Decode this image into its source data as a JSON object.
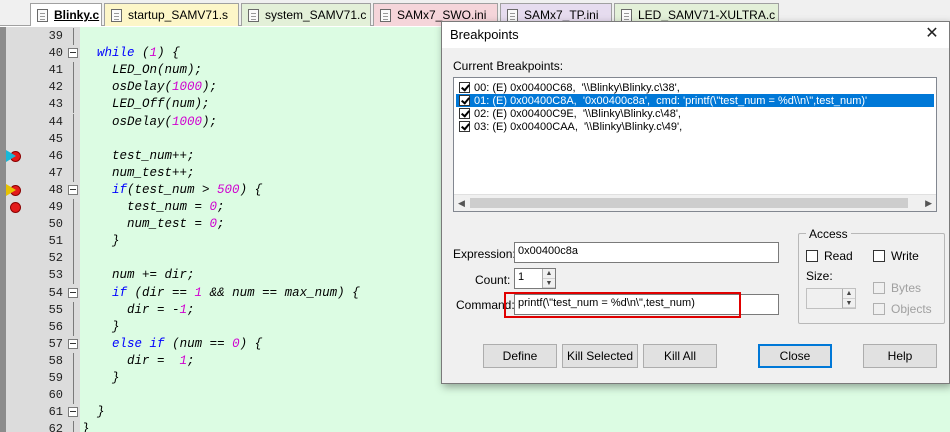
{
  "tabs": [
    {
      "label": "Blinky.c",
      "active": true,
      "color": "#ffffff"
    },
    {
      "label": "startup_SAMV71.s",
      "active": false,
      "color": "#fdf6c8"
    },
    {
      "label": "system_SAMV71.c",
      "active": false,
      "color": "#e3f0d8"
    },
    {
      "label": "SAMx7_SWO.ini",
      "active": false,
      "color": "#f5d5da"
    },
    {
      "label": "SAMx7_TP.ini",
      "active": false,
      "color": "#e6dcef"
    },
    {
      "label": "LED_SAMV71-XULTRA.c",
      "active": false,
      "color": "#e3f0d8"
    }
  ],
  "editor": {
    "lines": [
      {
        "num": "39",
        "code": ""
      },
      {
        "num": "40",
        "code": "  while (1) {",
        "fold": true
      },
      {
        "num": "41",
        "code": "    LED_On(num);"
      },
      {
        "num": "42",
        "code": "    osDelay(1000);"
      },
      {
        "num": "43",
        "code": "    LED_Off(num);"
      },
      {
        "num": "44",
        "code": "    osDelay(1000);"
      },
      {
        "num": "45",
        "code": ""
      },
      {
        "num": "46",
        "code": "    test_num++;",
        "marker": "breakpoint-current"
      },
      {
        "num": "47",
        "code": "    num_test++;"
      },
      {
        "num": "48",
        "code": "    if(test_num > 500) {",
        "fold": true,
        "marker": "breakpoint-yellow"
      },
      {
        "num": "49",
        "code": "      test_num = 0;",
        "marker": "breakpoint"
      },
      {
        "num": "50",
        "code": "      num_test = 0;"
      },
      {
        "num": "51",
        "code": "    }"
      },
      {
        "num": "52",
        "code": ""
      },
      {
        "num": "53",
        "code": "    num += dir;"
      },
      {
        "num": "54",
        "code": "    if (dir == 1 && num == max_num) {",
        "fold": true
      },
      {
        "num": "55",
        "code": "      dir = -1;"
      },
      {
        "num": "56",
        "code": "    }"
      },
      {
        "num": "57",
        "code": "    else if (num == 0) {",
        "fold": true
      },
      {
        "num": "58",
        "code": "      dir =  1;"
      },
      {
        "num": "59",
        "code": "    }"
      },
      {
        "num": "60",
        "code": ""
      },
      {
        "num": "61",
        "code": "  }",
        "fold": true
      },
      {
        "num": "62",
        "code": "}"
      }
    ]
  },
  "dialog": {
    "title": "Breakpoints",
    "close_glyph": "✕",
    "current_label": "Current Breakpoints:",
    "breakpoints": [
      {
        "text": "00: (E) 0x00400C68,  '\\\\Blinky\\Blinky.c\\38',",
        "checked": true,
        "selected": false
      },
      {
        "text": "01: (E) 0x00400C8A,  '0x00400c8a',  cmd: 'printf(\\\"test_num = %d\\\\n\\\",test_num)'",
        "checked": true,
        "selected": true
      },
      {
        "text": "02: (E) 0x00400C9E,  '\\\\Blinky\\Blinky.c\\48',",
        "checked": true,
        "selected": false
      },
      {
        "text": "03: (E) 0x00400CAA,  '\\\\Blinky\\Blinky.c\\49',",
        "checked": true,
        "selected": false
      }
    ],
    "expression_label": "Expression:",
    "expression_value": "0x00400c8a",
    "count_label": "Count:",
    "count_value": "1",
    "command_label": "Command:",
    "command_value": "printf(\\\"test_num = %d\\n\\\",test_num)",
    "access_label": "Access",
    "read_label": "Read",
    "write_label": "Write",
    "size_label": "Size:",
    "bytes_label": "Bytes",
    "objects_label": "Objects",
    "buttons": {
      "define": "Define",
      "kill_selected": "Kill Selected",
      "kill_all": "Kill All",
      "close": "Close",
      "help": "Help"
    }
  }
}
